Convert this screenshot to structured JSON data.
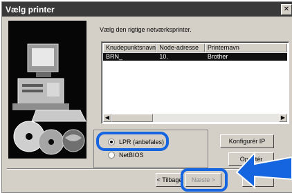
{
  "window": {
    "title": "Vælg printer"
  },
  "instruction": "Vælg den rigtige netværksprinter.",
  "list": {
    "columns": [
      "Knudepunktsnavn",
      "Node-adresse",
      "Printernavn"
    ],
    "rows": [
      {
        "node_name": "BRN_",
        "node_address": "10.",
        "printer_name": "Brother"
      }
    ]
  },
  "protocol": {
    "options": [
      {
        "label": "LPR (anbefales)",
        "checked": true
      },
      {
        "label": "NetBIOS",
        "checked": false
      }
    ]
  },
  "buttons": {
    "configure_ip": "Konfigurér IP",
    "update": "Opdatér",
    "back": "< Tilbage",
    "next": "Næste >"
  },
  "colors": {
    "highlight": "#1565e0",
    "titlebar": "#3a3a3a",
    "dialog": "#d4d0c8"
  }
}
